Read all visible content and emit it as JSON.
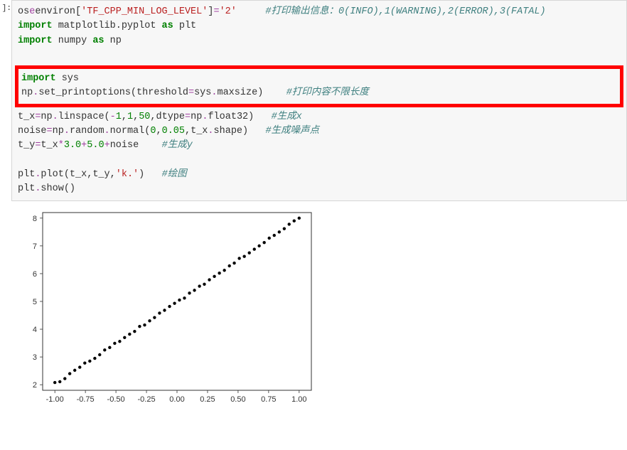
{
  "prompt": "]:",
  "code": {
    "l1a": "os",
    "l1b": "environ[",
    "l1c": "'TF_CPP_MIN_LOG_LEVEL'",
    "l1d": "]",
    "l1e": "=",
    "l1f": "'2'",
    "l1g": "     ",
    "l1h": "#打印输出信息：0(INFO),1(WARNING),2(ERROR),3(FATAL)",
    "l2a": "import",
    "l2b": " matplotlib.pyplot ",
    "l2c": "as",
    "l2d": " plt",
    "l3a": "import",
    "l3b": " numpy ",
    "l3c": "as",
    "l3d": " np",
    "l4a": "import",
    "l4b": " sys",
    "l5a": "np",
    "l5b": ".",
    "l5c": "set_printoptions(threshold",
    "l5d": "=",
    "l5e": "sys",
    "l5f": ".",
    "l5g": "maxsize)    ",
    "l5h": "#打印内容不限长度",
    "l6a": "t_x",
    "l6b": "=",
    "l6c": "np",
    "l6d": ".",
    "l6e": "linspace(",
    "l6f": "-",
    "l6g": "1",
    "l6h": ",",
    "l6i": "1",
    "l6j": ",",
    "l6k": "50",
    "l6l": ",dtype",
    "l6m": "=",
    "l6n": "np",
    "l6o": ".",
    "l6p": "float32)   ",
    "l6q": "#生成x",
    "l7a": "noise",
    "l7b": "=",
    "l7c": "np",
    "l7d": ".",
    "l7e": "random",
    "l7f": ".",
    "l7g": "normal(",
    "l7h": "0",
    "l7i": ",",
    "l7j": "0.05",
    "l7k": ",t_x",
    "l7l": ".",
    "l7m": "shape)   ",
    "l7n": "#生成噪声点",
    "l8a": "t_y",
    "l8b": "=",
    "l8c": "t_x",
    "l8d": "*",
    "l8e": "3.0",
    "l8f": "+",
    "l8g": "5.0",
    "l8h": "+",
    "l8i": "noise    ",
    "l8j": "#生成y",
    "l9a": "plt",
    "l9b": ".",
    "l9c": "plot(t_x,t_y,",
    "l9d": "'k.'",
    "l9e": ")   ",
    "l9f": "#绘图",
    "l10a": "plt",
    "l10b": ".",
    "l10c": "show()"
  },
  "chart_data": {
    "type": "scatter",
    "title": "",
    "xlabel": "",
    "ylabel": "",
    "xlim": [
      -1.1,
      1.1
    ],
    "ylim": [
      1.8,
      8.2
    ],
    "xticks": [
      "-1.00",
      "-0.75",
      "-0.50",
      "-0.25",
      "0.00",
      "0.25",
      "0.50",
      "0.75",
      "1.00"
    ],
    "yticks": [
      "2",
      "3",
      "4",
      "5",
      "6",
      "7",
      "8"
    ],
    "x": [
      -1.0,
      -0.959,
      -0.918,
      -0.878,
      -0.837,
      -0.796,
      -0.755,
      -0.714,
      -0.673,
      -0.633,
      -0.592,
      -0.551,
      -0.51,
      -0.469,
      -0.429,
      -0.388,
      -0.347,
      -0.306,
      -0.265,
      -0.224,
      -0.184,
      -0.143,
      -0.102,
      -0.061,
      -0.02,
      0.02,
      0.061,
      0.102,
      0.143,
      0.184,
      0.224,
      0.265,
      0.306,
      0.347,
      0.388,
      0.429,
      0.469,
      0.51,
      0.551,
      0.592,
      0.633,
      0.673,
      0.714,
      0.755,
      0.796,
      0.837,
      0.878,
      0.918,
      0.959,
      1.0
    ],
    "y": [
      2.08,
      2.11,
      2.22,
      2.4,
      2.52,
      2.63,
      2.78,
      2.85,
      2.95,
      3.08,
      3.25,
      3.34,
      3.49,
      3.56,
      3.7,
      3.82,
      3.92,
      4.1,
      4.15,
      4.3,
      4.42,
      4.58,
      4.68,
      4.82,
      4.93,
      5.05,
      5.12,
      5.3,
      5.4,
      5.55,
      5.62,
      5.78,
      5.9,
      6.02,
      6.12,
      6.28,
      6.38,
      6.55,
      6.62,
      6.75,
      6.88,
      7.0,
      7.12,
      7.28,
      7.38,
      7.5,
      7.62,
      7.78,
      7.9,
      8.0
    ]
  }
}
